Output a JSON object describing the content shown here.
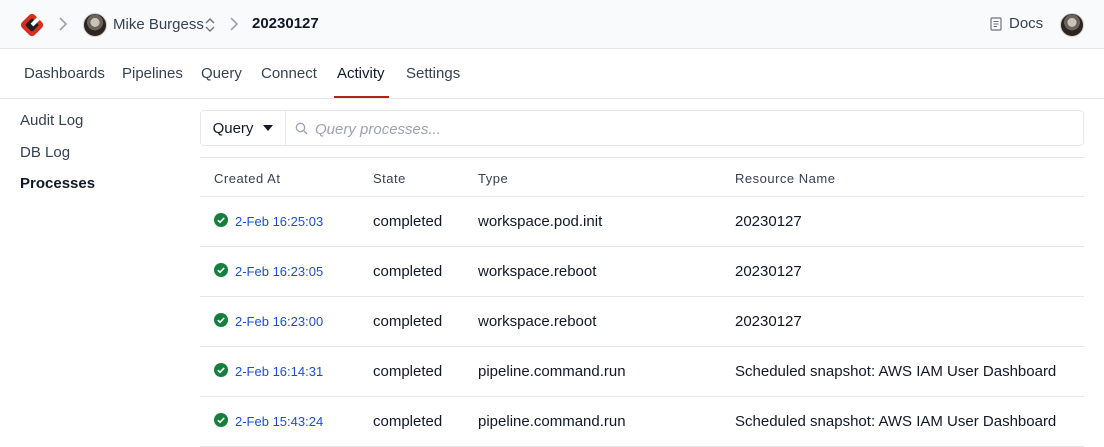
{
  "header": {
    "user_name": "Mike Burgess",
    "workspace_name": "20230127",
    "docs_label": "Docs"
  },
  "tabs": [
    {
      "label": "Dashboards"
    },
    {
      "label": "Pipelines"
    },
    {
      "label": "Query"
    },
    {
      "label": "Connect"
    },
    {
      "label": "Activity",
      "active": true
    },
    {
      "label": "Settings"
    }
  ],
  "sidebar": {
    "items": [
      {
        "label": "Audit Log"
      },
      {
        "label": "DB Log"
      },
      {
        "label": "Processes",
        "active": true
      }
    ]
  },
  "search": {
    "mode_label": "Query",
    "placeholder": "Query processes..."
  },
  "table": {
    "columns": [
      "Created At",
      "State",
      "Type",
      "Resource Name"
    ],
    "rows": [
      {
        "created_at": "2-Feb 16:25:03",
        "state": "completed",
        "type": "workspace.pod.init",
        "resource": "20230127"
      },
      {
        "created_at": "2-Feb 16:23:05",
        "state": "completed",
        "type": "workspace.reboot",
        "resource": "20230127"
      },
      {
        "created_at": "2-Feb 16:23:00",
        "state": "completed",
        "type": "workspace.reboot",
        "resource": "20230127"
      },
      {
        "created_at": "2-Feb 16:14:31",
        "state": "completed",
        "type": "pipeline.command.run",
        "resource": "Scheduled snapshot: AWS IAM User Dashboard"
      },
      {
        "created_at": "2-Feb 15:43:24",
        "state": "completed",
        "type": "pipeline.command.run",
        "resource": "Scheduled snapshot: AWS IAM User Dashboard"
      }
    ]
  },
  "colors": {
    "accent": "#b42318",
    "link": "#1d4ed8",
    "success": "#15803d"
  },
  "icons": [
    "logo-icon",
    "chevron-right-icon",
    "updown-icon",
    "docs-icon",
    "search-icon",
    "check-circle-icon",
    "caret-down-icon"
  ]
}
